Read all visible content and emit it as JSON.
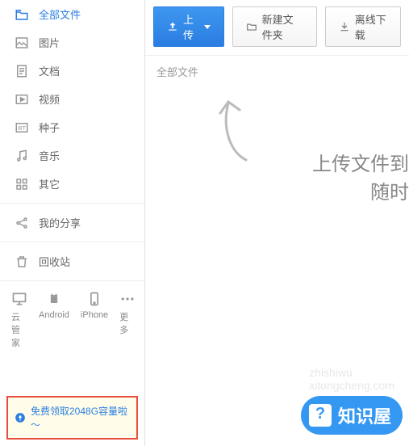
{
  "sidebar": {
    "items": [
      {
        "label": "全部文件",
        "icon": "cloud-folder-icon",
        "active": true
      },
      {
        "label": "图片",
        "icon": "image-icon"
      },
      {
        "label": "文档",
        "icon": "document-icon"
      },
      {
        "label": "视频",
        "icon": "video-icon"
      },
      {
        "label": "种子",
        "icon": "bt-icon"
      },
      {
        "label": "音乐",
        "icon": "music-icon"
      },
      {
        "label": "其它",
        "icon": "other-icon"
      }
    ],
    "share": {
      "label": "我的分享"
    },
    "recycle": {
      "label": "回收站"
    },
    "devices": [
      {
        "label": "云管家"
      },
      {
        "label": "Android"
      },
      {
        "label": "iPhone"
      },
      {
        "label": "更多"
      }
    ],
    "promo": {
      "text": "免费领取2048G容量啦～"
    }
  },
  "toolbar": {
    "upload_label": "上传",
    "new_folder_label": "新建文件夹",
    "offline_label": "离线下载"
  },
  "breadcrumb": {
    "path": "全部文件"
  },
  "content": {
    "hint1": "上传文件到",
    "hint2": "随时",
    "watermark_site": "zhishiwu",
    "watermark_url": "xitongcheng.com"
  },
  "brand": {
    "name": "知识屋"
  }
}
